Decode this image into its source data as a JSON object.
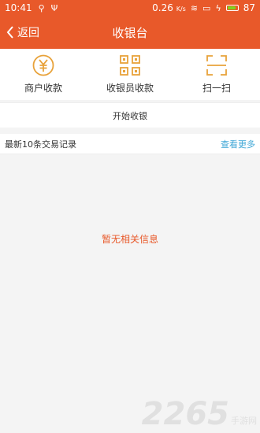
{
  "status_bar": {
    "time": "10:41",
    "network_speed": "0.26",
    "network_unit": "K/s",
    "battery": "87"
  },
  "nav": {
    "back_label": "返回",
    "title": "收银台"
  },
  "actions": [
    {
      "label": "商户收款",
      "icon": "yen-coin-icon"
    },
    {
      "label": "收银员收款",
      "icon": "qr-code-icon"
    },
    {
      "label": "扫一扫",
      "icon": "scan-icon"
    }
  ],
  "start_cashier": "开始收银",
  "records": {
    "title": "最新10条交易记录",
    "view_more": "查看更多",
    "empty_message": "暂无相关信息"
  },
  "watermark": {
    "big": "2265",
    "small": "手游网"
  },
  "colors": {
    "accent": "#e8592a",
    "link": "#3fa7d6",
    "icon": "#e8a23a"
  }
}
